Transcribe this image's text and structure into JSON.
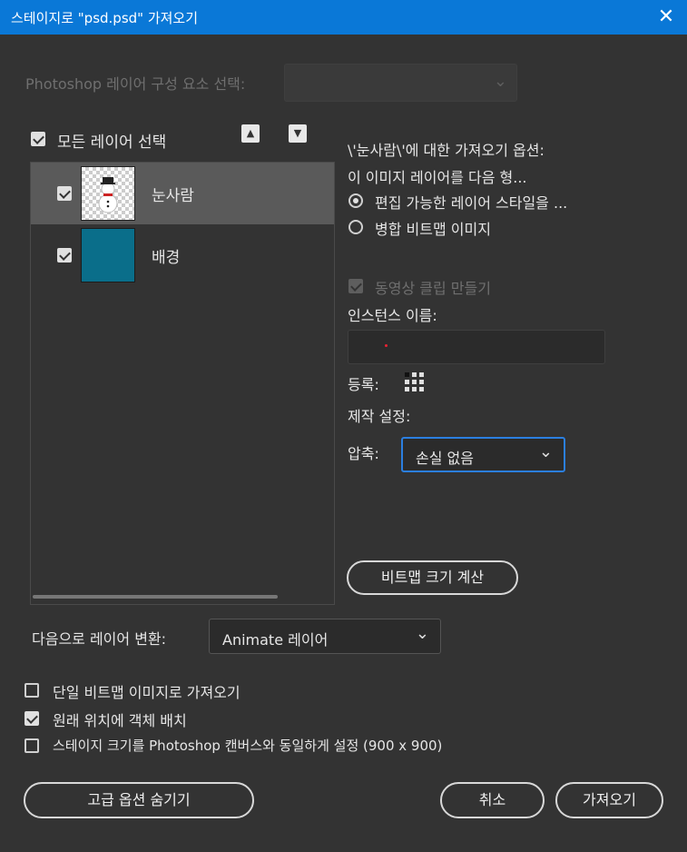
{
  "window": {
    "title": "스테이지로 \"psd.psd\" 가져오기",
    "close_glyph": "✕"
  },
  "comp_select": {
    "label": "Photoshop 레이어 구성 요소 선택:",
    "value": ""
  },
  "layers_panel": {
    "select_all_label": "모든 레이어 선택",
    "select_all_checked": true,
    "layers": [
      {
        "name": "눈사람",
        "checked": true,
        "selected": true,
        "thumb": "snowman-thumbnail"
      },
      {
        "name": "배경",
        "checked": true,
        "selected": false,
        "thumb": "teal-fill-thumbnail",
        "thumb_color": "#0a6e8a"
      }
    ]
  },
  "options": {
    "heading": "\\'눈사람\\'에 대한 가져오기 옵션:",
    "import_as_label": "이 이미지 레이어를 다음 형...",
    "radio_editable": "편집 가능한 레이어 스타일을 ...",
    "radio_flatten": "병합 비트맵 이미지",
    "movie_clip_label": "동영상 클립 만들기",
    "instance_name_label": "인스턴스 이름:",
    "instance_name_value": "",
    "registration_label": "등록:",
    "publish_settings_label": "제작 설정:",
    "compression_label": "압축:",
    "compression_value": "손실 없음",
    "calc_bitmap_button": "비트맵 크기 계산"
  },
  "convert": {
    "label": "다음으로 레이어 변환:",
    "value": "Animate 레이어"
  },
  "bottom_checks": [
    {
      "label": "단일 비트맵 이미지로 가져오기",
      "checked": false
    },
    {
      "label": "원래 위치에 객체 배치",
      "checked": true
    },
    {
      "label": "스테이지 크기를 Photoshop 캔버스와 동일하게 설정 (900 x 900)",
      "checked": false
    }
  ],
  "buttons": {
    "hide_advanced": "고급 옵션 숨기기",
    "cancel": "취소",
    "import": "가져오기"
  },
  "colors": {
    "titlebar": "#0a78d7",
    "background": "#333333",
    "focus": "#2b7fe0"
  }
}
